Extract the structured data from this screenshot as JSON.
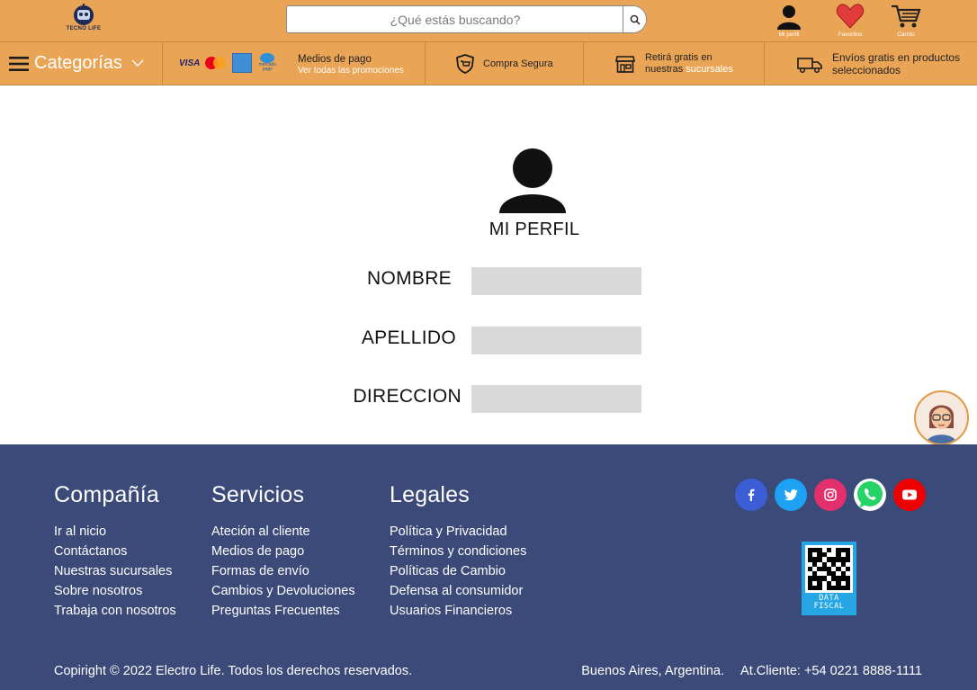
{
  "brand": {
    "logo_text": "TECNO LIFE"
  },
  "header": {
    "search_placeholder": "¿Qué estás buscando?",
    "icons": [
      {
        "name": "user-icon",
        "label": "Mi perfil"
      },
      {
        "name": "heart-icon",
        "label": "Favoritos"
      },
      {
        "name": "cart-icon",
        "label": "Carrito"
      }
    ]
  },
  "nav": {
    "categories_label": "Categorías",
    "payment_cards": [
      "VISA",
      "mastercard",
      "american-express",
      "mercado pago"
    ],
    "payment_title": "Medios de pago",
    "payment_subtitle": "Ver todas las promociones",
    "secure_label": "Compra Segura",
    "pickup_line1": "Retirá gratis en",
    "pickup_line2_a": "nuestras",
    "pickup_line2_b": "sucursales",
    "shipping_line1": "Envíos gratis en productos",
    "shipping_line2": "seleccionados"
  },
  "profile": {
    "title": "MI PERFIL",
    "fields": [
      {
        "label": "NOMBRE",
        "value": ""
      },
      {
        "label": "APELLIDO",
        "value": ""
      },
      {
        "label": "DIRECCION",
        "value": ""
      }
    ]
  },
  "footer": {
    "columns": [
      {
        "title": "Compañía",
        "links": [
          "Ir al nicio",
          "Contáctanos",
          "Nuestras sucursales",
          "Sobre nosotros",
          "Trabaja con nosotros"
        ]
      },
      {
        "title": "Servicios",
        "links": [
          "Ateción al cliente",
          "Medios de pago",
          "Formas de envío",
          "Cambios y Devoluciones",
          "Preguntas Frecuentes"
        ]
      },
      {
        "title": "Legales",
        "links": [
          "Política y Privacidad",
          "Términos y condiciones",
          "Políticas de Cambio",
          "Defensa al consumidor",
          "Usuarios Financieros"
        ]
      }
    ],
    "social": [
      {
        "name": "facebook-icon",
        "glyph": "f",
        "color": "#3b5ed6"
      },
      {
        "name": "twitter-icon",
        "glyph": "t",
        "color": "#1da1f2"
      },
      {
        "name": "instagram-icon",
        "glyph": "ig",
        "color": "#e1306c"
      },
      {
        "name": "whatsapp-icon",
        "glyph": "wa",
        "color": "#25d366"
      },
      {
        "name": "youtube-icon",
        "glyph": "yt",
        "color": "#ee0000"
      }
    ],
    "qr_text_1": "DATA",
    "qr_text_2": "FISCAL",
    "copyright": "Copiright © 2022 Electro Life.  Todos los derechos reservados.",
    "location": "Buenos Aires, Argentina.",
    "customer_service": "At.Cliente: +54 0221 8888-1111"
  },
  "colors": {
    "accent": "#eaa455",
    "footer": "#3b4a78",
    "field": "#d9d9d9"
  }
}
